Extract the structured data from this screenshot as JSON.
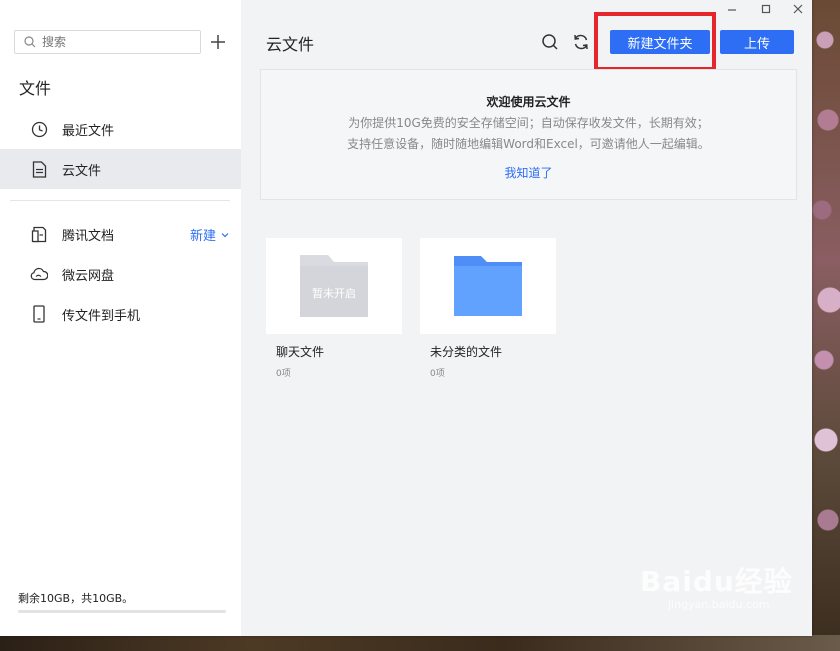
{
  "sidebar": {
    "search_placeholder": "搜索",
    "section_title": "文件",
    "items": [
      {
        "label": "最近文件",
        "icon": "clock-icon"
      },
      {
        "label": "云文件",
        "icon": "document-icon"
      },
      {
        "label": "腾讯文档",
        "icon": "tencent-docs-icon"
      },
      {
        "label": "微云网盘",
        "icon": "cloud-icon"
      },
      {
        "label": "传文件到手机",
        "icon": "phone-icon"
      }
    ],
    "new_link": "新建",
    "storage_text": "剩余10GB，共10GB。",
    "storage_used_fraction": 0
  },
  "header": {
    "title": "云文件",
    "new_folder_label": "新建文件夹",
    "upload_label": "上传"
  },
  "welcome": {
    "title": "欢迎使用云文件",
    "line1": "为你提供10G免费的安全存储空间；自动保存收发文件，长期有效；",
    "line2": "支持任意设备，随时随地编辑Word和Excel，可邀请他人一起编辑。",
    "dismiss": "我知道了"
  },
  "folders": [
    {
      "name": "聊天文件",
      "count": "0项",
      "thumb_text": "暂未开启"
    },
    {
      "name": "未分类的文件",
      "count": "0项"
    }
  ],
  "watermark": {
    "main": "Baidu经验",
    "sub": "jingyan.baidu.com"
  },
  "colors": {
    "accent": "#2d6ef5",
    "highlight": "#e5262c"
  }
}
